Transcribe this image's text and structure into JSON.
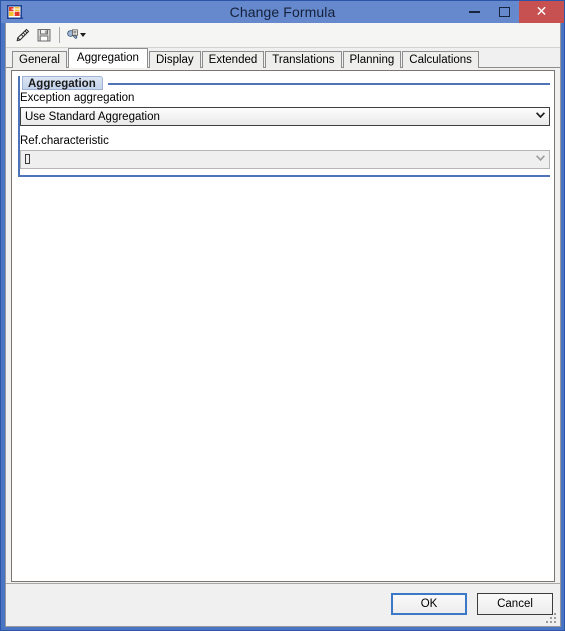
{
  "window": {
    "title": "Change Formula",
    "icon": "sap-bex-formula-icon",
    "controls": {
      "minimize": "—",
      "maximize": "□",
      "close": "✕"
    }
  },
  "toolbar": {
    "buttons": [
      {
        "name": "edit-pencil-icon",
        "label": "",
        "tooltip": "Edit"
      },
      {
        "name": "save-icon",
        "label": "",
        "tooltip": "Save"
      },
      {
        "name": "tools-wrench-icon",
        "label": "",
        "tooltip": "Tools",
        "has_dropdown": true
      }
    ]
  },
  "tabs": [
    {
      "label": "General",
      "active": false
    },
    {
      "label": "Aggregation",
      "active": true
    },
    {
      "label": "Display",
      "active": false
    },
    {
      "label": "Extended",
      "active": false
    },
    {
      "label": "Translations",
      "active": false
    },
    {
      "label": "Planning",
      "active": false
    },
    {
      "label": "Calculations",
      "active": false
    }
  ],
  "content": {
    "groupbox": {
      "legend": "Aggregation"
    },
    "fields": [
      {
        "label": "Exception aggregation",
        "value": "Use Standard Aggregation",
        "enabled": true,
        "arrow": "❯"
      },
      {
        "label": "Ref.characteristic",
        "value": "",
        "enabled": false,
        "arrow": "❯"
      }
    ]
  },
  "footer": {
    "ok_label": "OK",
    "cancel_label": "Cancel"
  },
  "colors": {
    "title_bar": "#6688cc",
    "window_border": "#4a74c4",
    "close_button": "#c75050",
    "group_border": "#4d74b8",
    "default_button_border": "#3c78c8"
  }
}
